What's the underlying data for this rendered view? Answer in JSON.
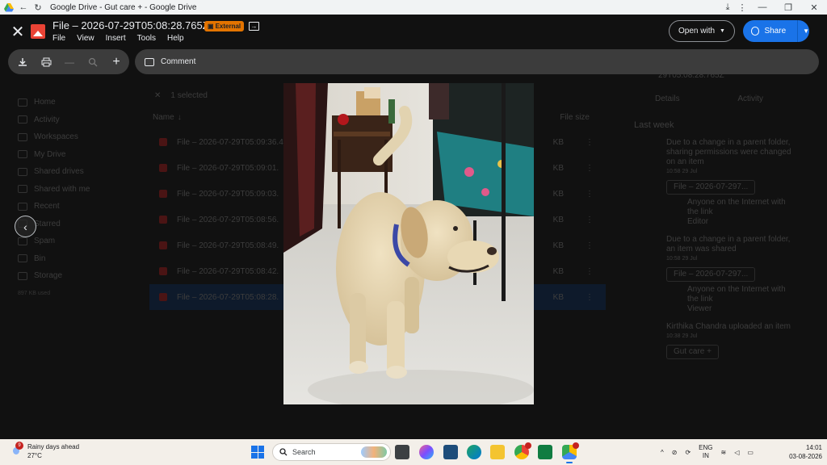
{
  "browser": {
    "title": "Google Drive - Gut care + - Google Drive"
  },
  "viewer": {
    "file_title": "File – 2026-07-29T05:08:28.765Z",
    "external_badge": "External",
    "menu": [
      "File",
      "View",
      "Insert",
      "Tools",
      "Help"
    ],
    "open_with_label": "Open with",
    "share_label": "Share",
    "comment_label": "Comment"
  },
  "background_drive": {
    "nav": [
      "Home",
      "Activity",
      "Workspaces",
      "My Drive",
      "Shared drives",
      "Shared with me",
      "Recent",
      "Starred",
      "Spam",
      "Bin",
      "Storage"
    ],
    "storage_used": "897 KB used",
    "selected_count": "1 selected",
    "column_name": "Name",
    "column_size": "File size",
    "files": [
      {
        "name": "File – 2026-07-29T05:09:36.4",
        "size": "KB"
      },
      {
        "name": "File – 2026-07-29T05:09:01.",
        "size": "KB"
      },
      {
        "name": "File – 2026-07-29T05:09:03.",
        "size": "KB"
      },
      {
        "name": "File – 2026-07-29T05:08:56.",
        "size": "KB"
      },
      {
        "name": "File – 2026-07-29T05:08:49.",
        "size": "KB"
      },
      {
        "name": "File – 2026-07-29T05:08:42.",
        "size": "KB"
      },
      {
        "name": "File – 2026-07-29T05:08:28.",
        "size": "KB"
      }
    ],
    "details_title": "29T05:08:28.765Z",
    "tab_details": "Details",
    "tab_activity": "Activity",
    "section": "Last week",
    "activity": [
      {
        "text": "Due to a change in a parent folder, sharing permissions were changed on an item",
        "time": "10:58 29 Jul",
        "chip": "File – 2026-07-297...",
        "sub": "Anyone on the Internet with the link",
        "role": "Editor"
      },
      {
        "text": "Due to a change in a parent folder, an item was shared",
        "time": "10:58 29 Jul",
        "chip": "File – 2026-07-297...",
        "sub": "Anyone on the Internet with the link",
        "role": "Viewer"
      },
      {
        "text": "Kirthika Chandra uploaded an item",
        "time": "10:38 29 Jul",
        "chip": "Gut care +"
      }
    ]
  },
  "taskbar": {
    "weather_title": "Rainy days ahead",
    "weather_temp": "27°C",
    "weather_badge": "9",
    "search_placeholder": "Search",
    "lang_top": "ENG",
    "lang_bottom": "IN",
    "time": "14:01",
    "date": "03-08-2026"
  },
  "colors": {
    "share_blue": "#1a73e8",
    "external_orange": "#e37400",
    "image_icon_red": "#ea4335"
  }
}
